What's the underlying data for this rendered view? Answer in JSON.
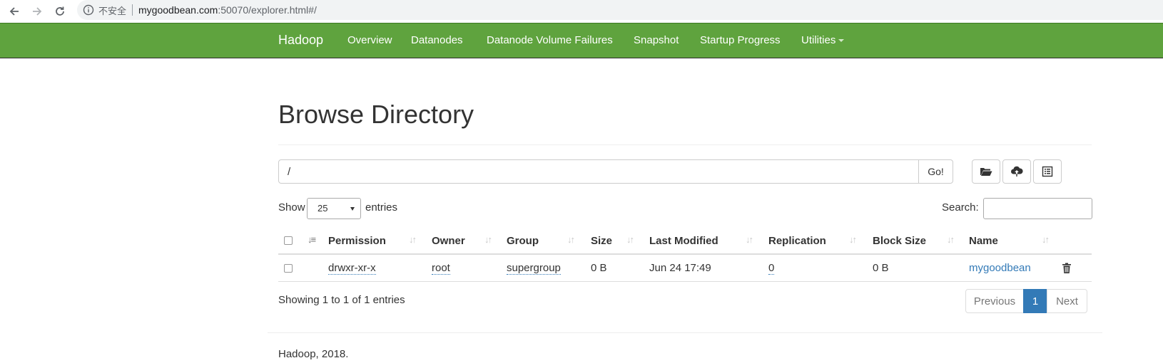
{
  "browser": {
    "security_label": "不安全",
    "url_host": "mygoodbean.com",
    "url_rest": ":50070/explorer.html#/"
  },
  "navbar": {
    "brand": "Hadoop",
    "items": [
      {
        "label": "Overview"
      },
      {
        "label": "Datanodes"
      },
      {
        "label": "Datanode Volume Failures"
      },
      {
        "label": "Snapshot"
      },
      {
        "label": "Startup Progress"
      },
      {
        "label": "Utilities"
      }
    ],
    "background_color": "#5fa33e"
  },
  "page": {
    "title": "Browse Directory",
    "path_value": "/",
    "go_label": "Go!",
    "toolbar_icons": [
      "folder-open-icon",
      "cloud-upload-icon",
      "list-alt-icon"
    ]
  },
  "table_controls": {
    "show_label": "Show",
    "page_length": "25",
    "entries_label": "entries",
    "search_label": "Search:",
    "search_value": ""
  },
  "table": {
    "columns": [
      "Permission",
      "Owner",
      "Group",
      "Size",
      "Last Modified",
      "Replication",
      "Block Size",
      "Name"
    ],
    "rows": [
      {
        "permission": "drwxr-xr-x",
        "owner": "root",
        "group": "supergroup",
        "size": "0 B",
        "last_modified": "Jun 24 17:49",
        "replication": "0",
        "block_size": "0 B",
        "name": "mygoodbean"
      }
    ]
  },
  "pagination": {
    "info": "Showing 1 to 1 of 1 entries",
    "previous": "Previous",
    "current": "1",
    "next": "Next",
    "active_color": "#337ab7"
  },
  "footer": {
    "text": "Hadoop, 2018."
  }
}
